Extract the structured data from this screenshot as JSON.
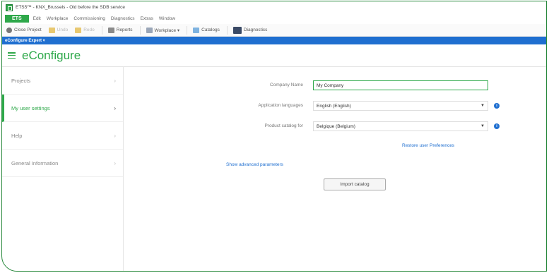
{
  "window": {
    "title": "ETS5™ - KNX_Brussels - Old before the SDB service"
  },
  "menubar": {
    "ets_tab": "ETS",
    "items": [
      "Edit",
      "Workplace",
      "Commissioning",
      "Diagnostics",
      "Extras",
      "Window"
    ]
  },
  "toolbar": {
    "close_project": "Close Project",
    "undo": "Undo",
    "redo": "Redo",
    "reports": "Reports",
    "workplace": "Workplace ▾",
    "catalogs": "Catalogs",
    "diagnostics": "Diagnostics"
  },
  "bluebar": {
    "label": "eConfigure Expert ▾"
  },
  "header": {
    "title": "eConfigure"
  },
  "sidebar": {
    "items": [
      {
        "label": "Projects"
      },
      {
        "label": "My user settings"
      },
      {
        "label": "Help"
      },
      {
        "label": "General Information"
      }
    ]
  },
  "form": {
    "company_name_label": "Company Name",
    "company_name_value": "My Company",
    "app_lang_label": "Application languages",
    "app_lang_value": "English (English)",
    "catalog_label": "Product catalog for",
    "catalog_value": "Belgique (Belgium)",
    "restore_link": "Restore user Preferences",
    "advanced_link": "Show advanced parameters",
    "import_button": "Import catalog"
  },
  "colors": {
    "accent_green": "#2ea84a",
    "blue_bar": "#1f6fd0",
    "link_blue": "#1f6fd0"
  },
  "icons": [
    "app-icon",
    "close-project-icon",
    "undo-icon",
    "redo-icon",
    "reports-icon",
    "workplace-icon",
    "catalogs-icon",
    "diagnostics-icon",
    "hamburger-icon",
    "chevron-right-icon",
    "dropdown-arrow-icon",
    "info-icon"
  ]
}
